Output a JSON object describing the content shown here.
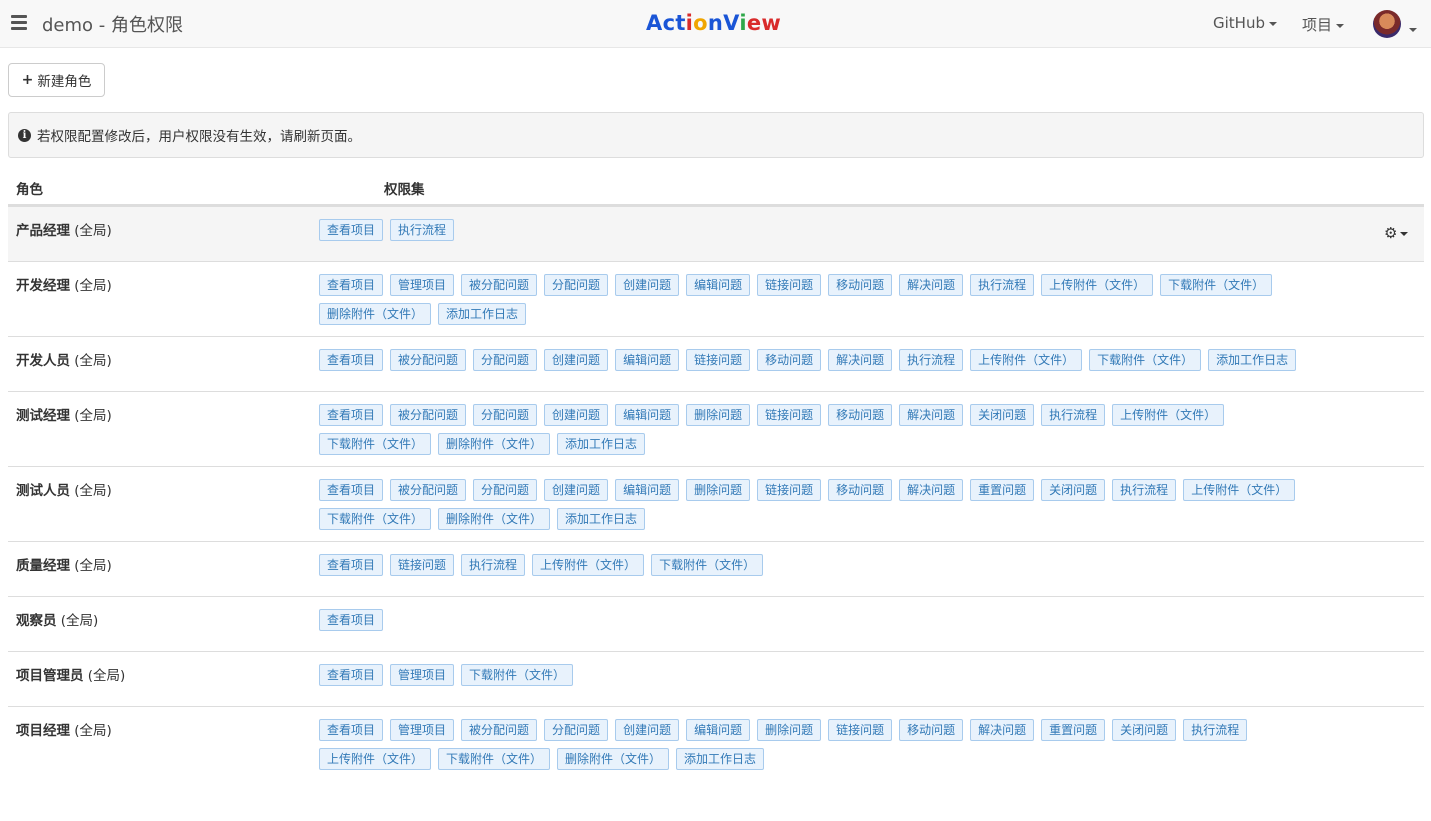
{
  "navbar": {
    "title": "demo - 角色权限",
    "logo": [
      {
        "ch": "A",
        "color": "#1a55d6"
      },
      {
        "ch": "c",
        "color": "#1a55d6"
      },
      {
        "ch": "t",
        "color": "#1a55d6"
      },
      {
        "ch": "i",
        "color": "#d92b2b"
      },
      {
        "ch": "o",
        "color": "#f0a500"
      },
      {
        "ch": "n",
        "color": "#1a55d6"
      },
      {
        "ch": "V",
        "color": "#1a55d6"
      },
      {
        "ch": "i",
        "color": "#2ea84a"
      },
      {
        "ch": "e",
        "color": "#d92b2b"
      },
      {
        "ch": "w",
        "color": "#d92b2b"
      }
    ],
    "github_label": "GitHub",
    "project_label": "项目"
  },
  "toolbar": {
    "new_role_label": "新建角色"
  },
  "alert": {
    "text": "若权限配置修改后，用户权限没有生效，请刷新页面。"
  },
  "table": {
    "col_role": "角色",
    "col_perms": "权限集",
    "rows": [
      {
        "role": "产品经理",
        "scope": "(全局)",
        "perms": [
          "查看项目",
          "执行流程"
        ]
      },
      {
        "role": "开发经理",
        "scope": "(全局)",
        "perms": [
          "查看项目",
          "管理项目",
          "被分配问题",
          "分配问题",
          "创建问题",
          "编辑问题",
          "链接问题",
          "移动问题",
          "解决问题",
          "执行流程",
          "上传附件（文件）",
          "下载附件（文件）",
          "删除附件（文件）",
          "添加工作日志"
        ]
      },
      {
        "role": "开发人员",
        "scope": "(全局)",
        "perms": [
          "查看项目",
          "被分配问题",
          "分配问题",
          "创建问题",
          "编辑问题",
          "链接问题",
          "移动问题",
          "解决问题",
          "执行流程",
          "上传附件（文件）",
          "下载附件（文件）",
          "添加工作日志"
        ]
      },
      {
        "role": "测试经理",
        "scope": "(全局)",
        "perms": [
          "查看项目",
          "被分配问题",
          "分配问题",
          "创建问题",
          "编辑问题",
          "删除问题",
          "链接问题",
          "移动问题",
          "解决问题",
          "关闭问题",
          "执行流程",
          "上传附件（文件）",
          "下载附件（文件）",
          "删除附件（文件）",
          "添加工作日志"
        ]
      },
      {
        "role": "测试人员",
        "scope": "(全局)",
        "perms": [
          "查看项目",
          "被分配问题",
          "分配问题",
          "创建问题",
          "编辑问题",
          "删除问题",
          "链接问题",
          "移动问题",
          "解决问题",
          "重置问题",
          "关闭问题",
          "执行流程",
          "上传附件（文件）",
          "下载附件（文件）",
          "删除附件（文件）",
          "添加工作日志"
        ]
      },
      {
        "role": "质量经理",
        "scope": "(全局)",
        "perms": [
          "查看项目",
          "链接问题",
          "执行流程",
          "上传附件（文件）",
          "下载附件（文件）"
        ]
      },
      {
        "role": "观察员",
        "scope": "(全局)",
        "perms": [
          "查看项目"
        ]
      },
      {
        "role": "项目管理员",
        "scope": "(全局)",
        "perms": [
          "查看项目",
          "管理项目",
          "下载附件（文件）"
        ]
      },
      {
        "role": "项目经理",
        "scope": "(全局)",
        "perms": [
          "查看项目",
          "管理项目",
          "被分配问题",
          "分配问题",
          "创建问题",
          "编辑问题",
          "删除问题",
          "链接问题",
          "移动问题",
          "解决问题",
          "重置问题",
          "关闭问题",
          "执行流程",
          "上传附件（文件）",
          "下载附件（文件）",
          "删除附件（文件）",
          "添加工作日志"
        ]
      }
    ]
  }
}
